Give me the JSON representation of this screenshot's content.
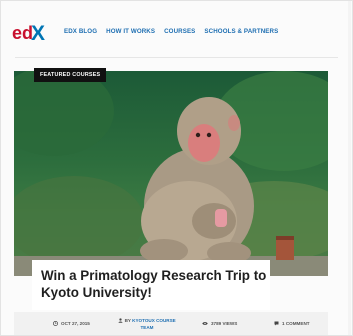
{
  "brand": {
    "logo_text": "edX"
  },
  "nav": {
    "items": [
      "EDX BLOG",
      "HOW IT WORKS",
      "COURSES",
      "SCHOOLS & PARTNERS"
    ]
  },
  "post": {
    "badge": "FEATURED COURSES",
    "title": "Win a Primatology Research Trip to Kyoto University!",
    "date": "OCT 27, 2015",
    "author_prefix": "BY",
    "author": "KYOTOUX COURSE TEAM",
    "views": "3789 VIEWS",
    "comments": "1 COMMENT"
  },
  "colors": {
    "brand_red": "#c8102e",
    "brand_blue": "#0075b4",
    "link": "#1f6fb2",
    "badge_bg": "#111111"
  },
  "icons": {
    "date": "clock-icon",
    "author": "user-icon",
    "views": "eye-icon",
    "comments": "comment-icon"
  }
}
